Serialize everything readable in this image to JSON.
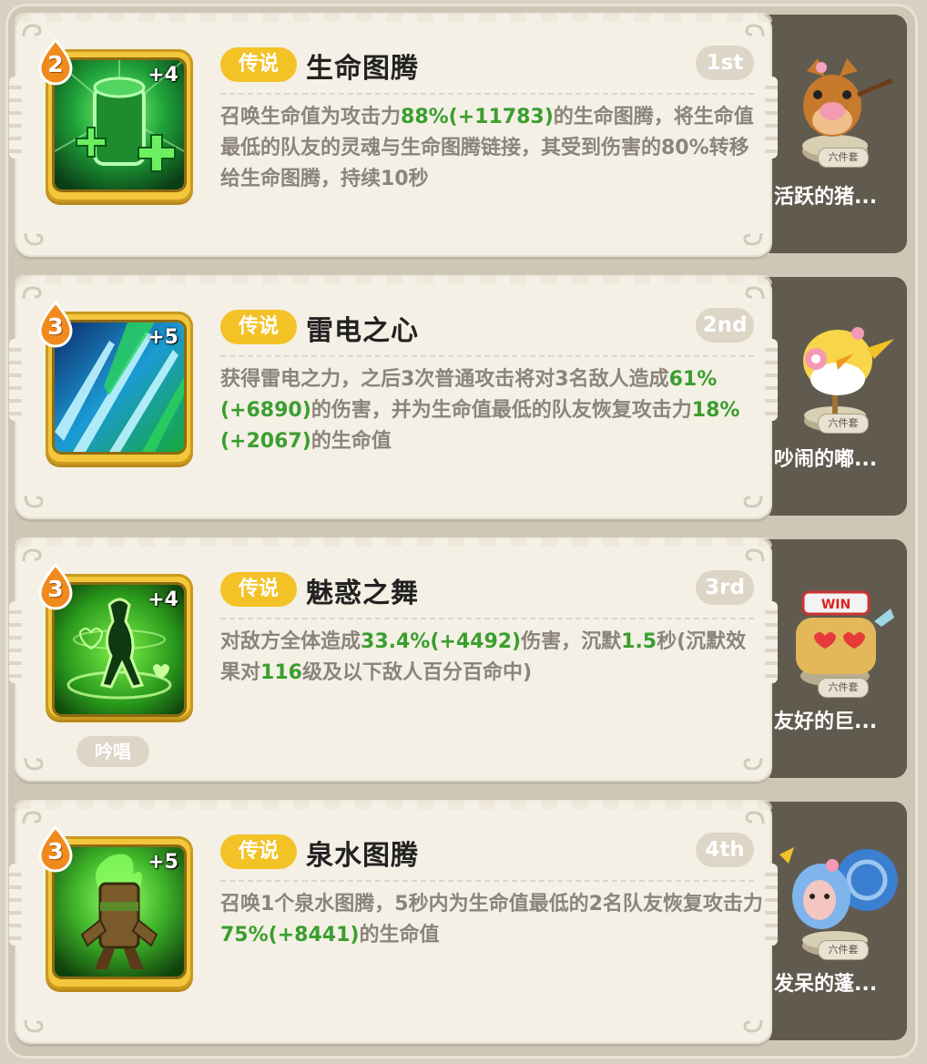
{
  "skills": [
    {
      "level": "2",
      "plus": "+4",
      "rarity": "传说",
      "name": "生命图腾",
      "rank": "1st",
      "chant": "",
      "desc": [
        {
          "t": "召唤生命值为攻击力"
        },
        {
          "t": "88%(+11783)",
          "hl": true
        },
        {
          "t": "的生命图腾，将生命值最低的队友的灵魂与生命图腾链接，其受到伤害的80%转移给生命图腾，持续10秒"
        }
      ],
      "mascot_badge": "六件套",
      "mascot_name": "活跃的猪..."
    },
    {
      "level": "3",
      "plus": "+5",
      "rarity": "传说",
      "name": "雷电之心",
      "rank": "2nd",
      "chant": "",
      "desc": [
        {
          "t": "获得雷电之力，之后3次普通攻击将对3名敌人造成"
        },
        {
          "t": "61%(+6890)",
          "hl": true
        },
        {
          "t": "的伤害，并为生命值最低的队友恢复攻击力"
        },
        {
          "t": "18%(+2067)",
          "hl": true
        },
        {
          "t": "的生命值"
        }
      ],
      "mascot_badge": "六件套",
      "mascot_name": "吵闹的嘟..."
    },
    {
      "level": "3",
      "plus": "+4",
      "rarity": "传说",
      "name": "魅惑之舞",
      "rank": "3rd",
      "chant": "吟唱",
      "desc": [
        {
          "t": "对敌方全体造成"
        },
        {
          "t": "33.4%(+4492)",
          "hl": true
        },
        {
          "t": "伤害，沉默"
        },
        {
          "t": "1.5",
          "hl": true
        },
        {
          "t": "秒(沉默效果对"
        },
        {
          "t": "116",
          "hl": true
        },
        {
          "t": "级及以下敌人百分百命中)"
        }
      ],
      "mascot_badge": "六件套",
      "mascot_name": "友好的巨..."
    },
    {
      "level": "3",
      "plus": "+5",
      "rarity": "传说",
      "name": "泉水图腾",
      "rank": "4th",
      "chant": "",
      "desc": [
        {
          "t": "召唤1个泉水图腾，5秒内为生命值最低的2名队友恢复攻击力"
        },
        {
          "t": "75%(+8441)",
          "hl": true
        },
        {
          "t": "的生命值"
        }
      ],
      "mascot_badge": "六件套",
      "mascot_name": "发呆的蓬..."
    }
  ],
  "colors": {
    "highlight": "#3a9e2f",
    "rarity_badge": "#f3c227",
    "level_drop": "#f08a1c"
  },
  "icons": [
    "life-totem-icon",
    "thunder-heart-icon",
    "charm-dance-icon",
    "spring-totem-icon"
  ],
  "mascots": [
    "boar-mascot",
    "chick-mascot",
    "golem-mascot",
    "sheep-mascot"
  ]
}
